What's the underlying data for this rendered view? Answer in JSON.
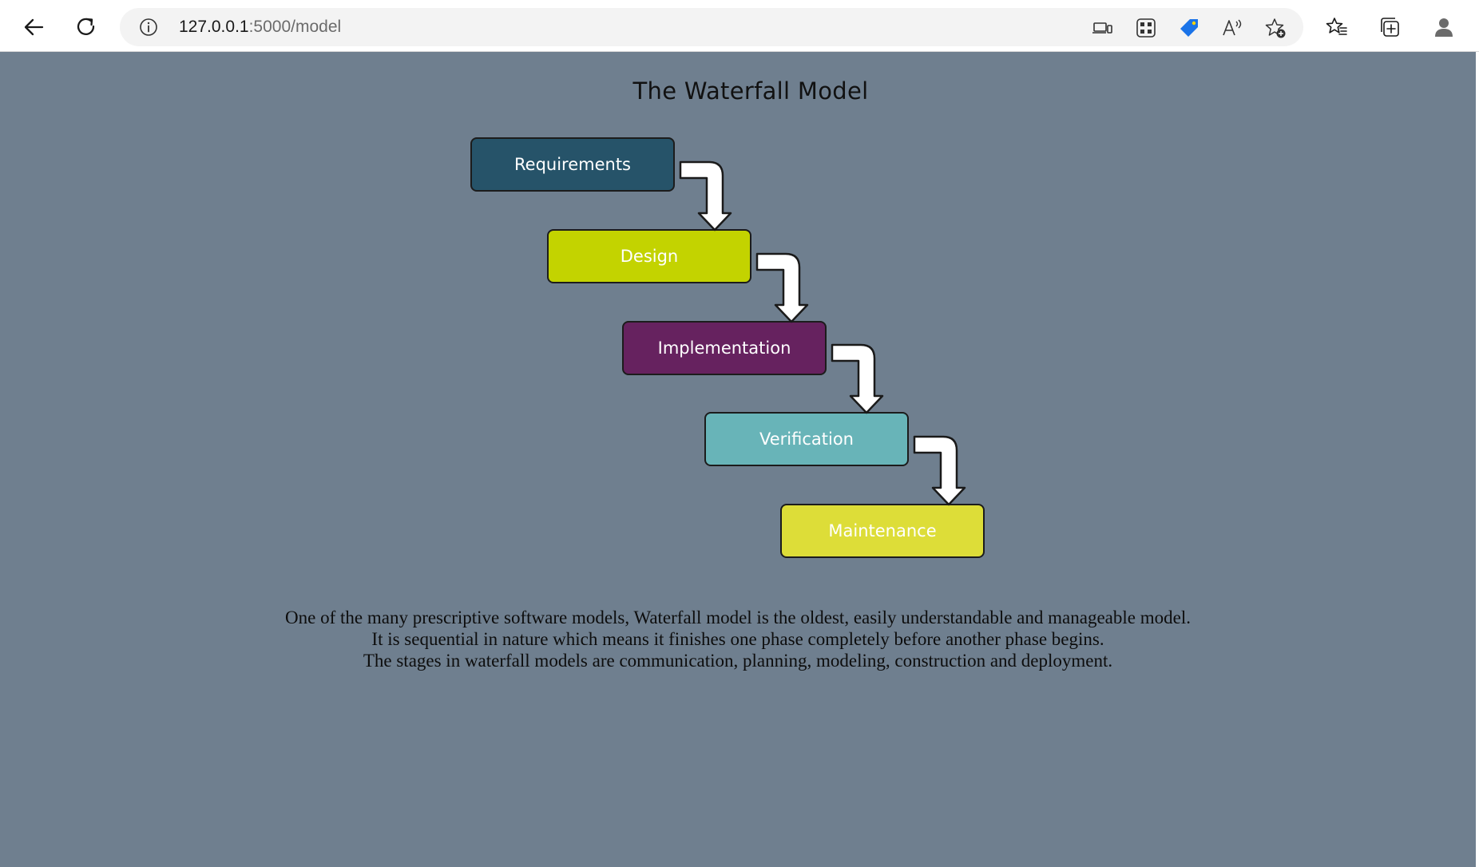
{
  "browser": {
    "url_host": "127.0.0.1",
    "url_path": ":5000/model",
    "icons": [
      "back-icon",
      "refresh-icon",
      "site-info-icon",
      "app-available-icon",
      "qr-code-icon",
      "shopping-tag-icon",
      "read-aloud-icon",
      "add-favorite-icon",
      "favorites-icon",
      "collections-icon",
      "profile-icon"
    ],
    "accent_color": "#1a73e8"
  },
  "page": {
    "title": "The Waterfall Model",
    "background_color": "#6f7f8f",
    "phases": [
      {
        "label": "Requirements",
        "color": "#265369"
      },
      {
        "label": "Design",
        "color": "#c3d300"
      },
      {
        "label": "Implementation",
        "color": "#66225f"
      },
      {
        "label": "Verification",
        "color": "#68b4b8"
      },
      {
        "label": "Maintenance",
        "color": "#dddd38"
      }
    ],
    "description": [
      "One of the many prescriptive software models, Waterfall model is the oldest, easily understandable and manageable model.",
      "It is sequential in nature which means it finishes one phase completely before another phase begins.",
      "The stages in waterfall models are communication, planning, modeling, construction and deployment."
    ]
  }
}
